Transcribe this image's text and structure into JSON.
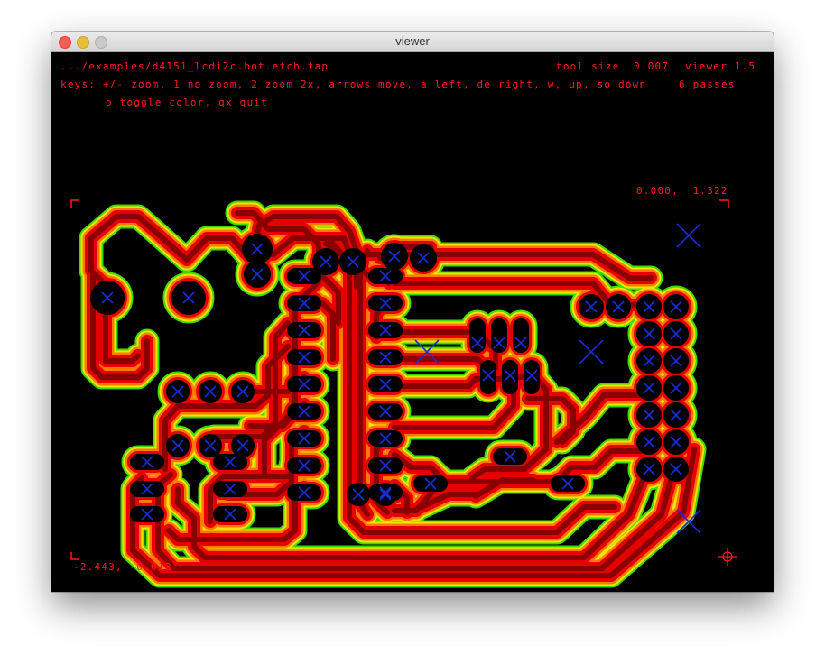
{
  "window": {
    "title": "viewer"
  },
  "hud": {
    "file_path": ".../examples/D4151_lcdi2c.bot.etch.tap",
    "tool_size": "tool size  0.007",
    "version": "Viewer 1.5",
    "keys_line1": "Keys: +/- zoom, 1 no zoom, 2 zoom 2x, arrows move, a left, de right, w, up, so down",
    "passes": "6 passes",
    "keys_line2": "O toggle color, qx quit",
    "coord_top_right": "0.000,  1.322",
    "coord_bottom_left": "-2.443, -0.013"
  },
  "colors": {
    "background": "#000000",
    "hud_text": "#ff1a1a",
    "trace_core": "#8a0000",
    "trace_pass_1": "#e60000",
    "trace_pass_2": "#ff7a00",
    "trace_pass_3": "#f2e400",
    "trace_outer": "#3cdc00",
    "drill_marker": "#1a2bd8"
  },
  "icons": [
    "crosshair-icon",
    "drill-x-icon"
  ]
}
